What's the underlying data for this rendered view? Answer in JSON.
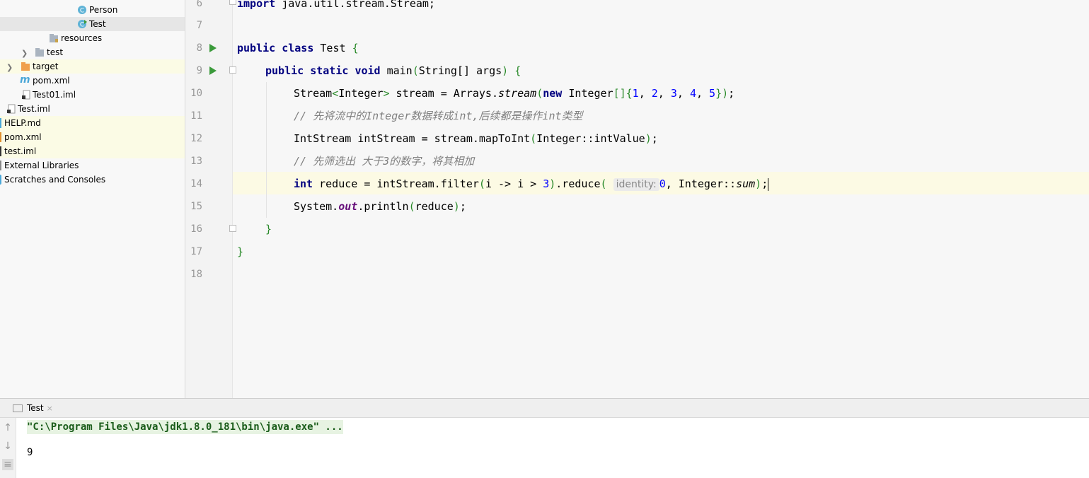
{
  "project_tree": [
    {
      "label": "Person",
      "icon": "java-class-icon"
    },
    {
      "label": "Test",
      "icon": "java-class-run-icon"
    },
    {
      "label": "resources",
      "icon": "resources-folder-icon"
    },
    {
      "label": "test",
      "icon": "folder-icon"
    },
    {
      "label": "target",
      "icon": "orange-folder-icon"
    },
    {
      "label": "pom.xml",
      "icon": "maven-icon"
    },
    {
      "label": "Test01.iml",
      "icon": "iml-file-icon"
    },
    {
      "label": "Test.iml",
      "icon": "iml-file-icon"
    },
    {
      "label": "HELP.md",
      "icon": "markdown-file-icon"
    },
    {
      "label": "pom.xml",
      "icon": "xml-file-icon"
    },
    {
      "label": "test.iml",
      "icon": "iml-file-icon"
    },
    {
      "label": "External Libraries",
      "icon": "libraries-icon"
    },
    {
      "label": "Scratches and Consoles",
      "icon": "scratches-icon"
    }
  ],
  "editor": {
    "line_numbers": [
      "6",
      "7",
      "8",
      "9",
      "10",
      "11",
      "12",
      "13",
      "14",
      "15",
      "16",
      "17",
      "18"
    ],
    "lines": {
      "l6": {
        "kw": "import",
        "rest": " java.util.stream.Stream;"
      },
      "l8": {
        "kw1": "public",
        "kw2": "class",
        "name": "Test",
        "brace": "{"
      },
      "l9": {
        "kw1": "public",
        "kw2": "static",
        "kw3": "void",
        "rest": "main",
        "p1": "(",
        "params": "String[] args",
        "p2": ")",
        "brace": " {"
      },
      "l10": {
        "a": "Stream",
        "lt": "<",
        "b": "Integer",
        "gt": ">",
        "c": " stream = Arrays.",
        "d": "stream",
        "p1": "(",
        "kw": "new",
        "e": " Integer",
        "br": "[]{",
        "n1": "1",
        "n2": "2",
        "n3": "3",
        "n4": "4",
        "n5": "5",
        "close": "})",
        "end": ";"
      },
      "l11": {
        "comment": "// 先将流中的Integer数据转成int,后续都是操作int类型"
      },
      "l12": {
        "a": "IntStream intStream = stream.mapToInt",
        "p1": "(",
        "b": "Integer::intValue",
        "p2": ")",
        "end": ";"
      },
      "l13": {
        "comment": "// 先筛选出 大于3的数字，将其相加"
      },
      "l14": {
        "kw": "int",
        "a": " reduce = intStream.filter",
        "p1": "(",
        "b": "i -> i > ",
        "n": "3",
        "p2": ")",
        ".reduce": ".reduce",
        "p3": "(",
        "hint": "identity:",
        "n0": "0",
        "c": ", Integer::",
        "d": "sum",
        "p4": ")",
        "end": ";"
      },
      "l15": {
        "a": "System.",
        "field": "out",
        "b": ".println",
        "p1": "(",
        "c": "reduce",
        "p2": ")",
        "end": ";"
      },
      "l16": {
        "brace": "}"
      },
      "l17": {
        "brace": "}"
      }
    }
  },
  "run_panel": {
    "tab_label": "Test",
    "tab_close": "×",
    "command": "\"C:\\Program Files\\Java\\jdk1.8.0_181\\bin\\java.exe\" ...",
    "output": "9"
  }
}
